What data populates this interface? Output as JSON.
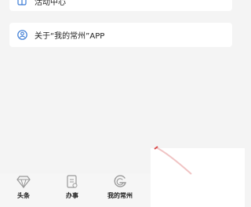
{
  "menu": {
    "activity_center": {
      "label": "活动中心",
      "icon": "activity-icon"
    },
    "about_app": {
      "label": "关于“我的常州”APP",
      "icon": "user-circle-icon"
    }
  },
  "tabbar": {
    "items": [
      {
        "label": "头条",
        "icon": "diamond-icon"
      },
      {
        "label": "办事",
        "icon": "document-icon"
      },
      {
        "label": "我的常州",
        "icon": "spiral-icon"
      }
    ]
  },
  "colors": {
    "icon_blue": "#3a7bd5",
    "tab_icon": "#9a9a9a"
  }
}
